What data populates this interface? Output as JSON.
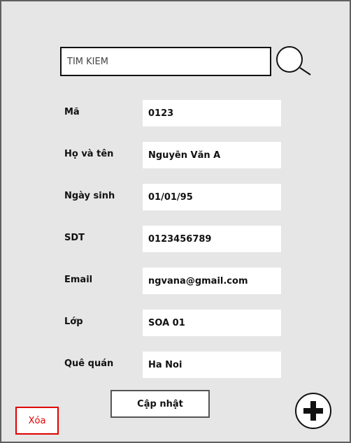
{
  "search": {
    "placeholder": "TÌM KIẾM",
    "icon": "search-icon"
  },
  "form": {
    "fields": [
      {
        "label": "Mã",
        "value": "0123"
      },
      {
        "label": "Họ và tên",
        "value": "Nguyễn Văn A"
      },
      {
        "label": "Ngày sinh",
        "value": "01/01/95"
      },
      {
        "label": "SDT",
        "value": "0123456789"
      },
      {
        "label": "Email",
        "value": "ngvana@gmail.com"
      },
      {
        "label": "Lớp",
        "value": "SOA 01"
      },
      {
        "label": "Quê quán",
        "value": "Ha Noi"
      }
    ]
  },
  "actions": {
    "update_label": "Cập nhật",
    "delete_label": "Xóa",
    "add_icon": "plus-circle-icon"
  },
  "colors": {
    "background": "#e6e6e6",
    "delete_accent": "#e00000"
  }
}
